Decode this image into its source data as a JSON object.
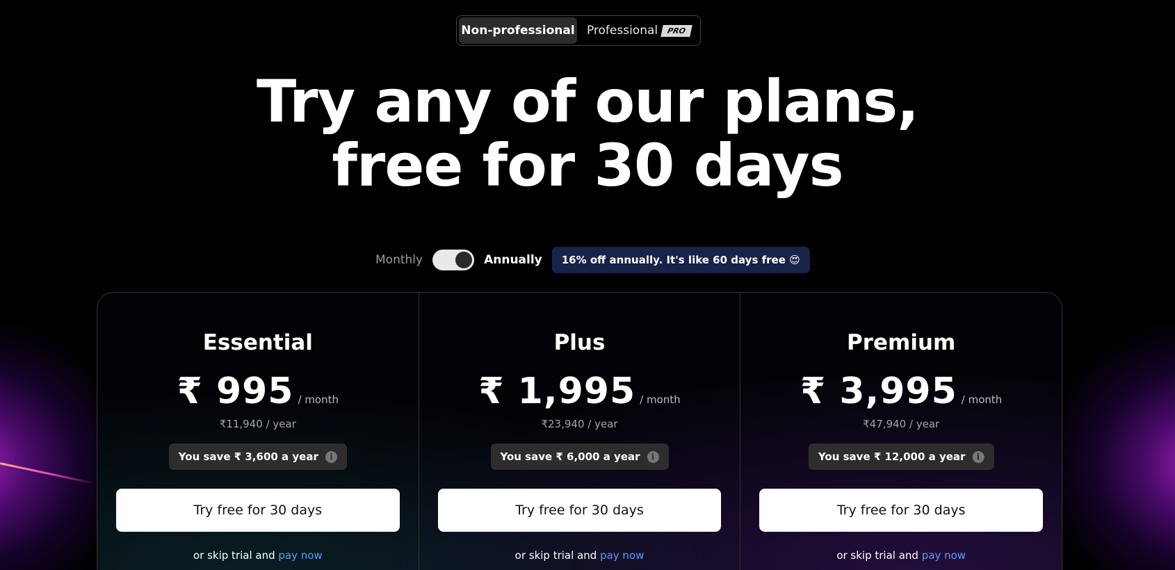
{
  "audience_tabs": {
    "active": "Non-professional",
    "inactive": "Professional",
    "pro_badge": "PRO"
  },
  "hero": {
    "line1": "Try any of our plans,",
    "line2": "free for 30 days"
  },
  "billing": {
    "monthly_label": "Monthly",
    "annual_label": "Annually",
    "selected": "Annually",
    "promo": "16% off annually. It's like 60 days free 😍"
  },
  "colors": {
    "background": "#000000",
    "promo_bg": "#182349",
    "link": "#5b9dff",
    "glow": "#c828dc"
  },
  "plans": [
    {
      "name": "Essential",
      "price": "₹ 995",
      "per_month": "/ month",
      "per_year": "₹11,940 / year",
      "save": "You save ₹ 3,600 a year",
      "cta": "Try free for 30 days",
      "skip_prefix": "or skip trial and",
      "skip_link": "pay now"
    },
    {
      "name": "Plus",
      "price": "₹ 1,995",
      "per_month": "/ month",
      "per_year": "₹23,940 / year",
      "save": "You save ₹ 6,000 a year",
      "cta": "Try free for 30 days",
      "skip_prefix": "or skip trial and",
      "skip_link": "pay now"
    },
    {
      "name": "Premium",
      "price": "₹ 3,995",
      "per_month": "/ month",
      "per_year": "₹47,940 / year",
      "save": "You save ₹ 12,000 a year",
      "cta": "Try free for 30 days",
      "skip_prefix": "or skip trial and",
      "skip_link": "pay now"
    }
  ],
  "icons": {
    "info": "info-icon",
    "toggle": "toggle-switch"
  }
}
